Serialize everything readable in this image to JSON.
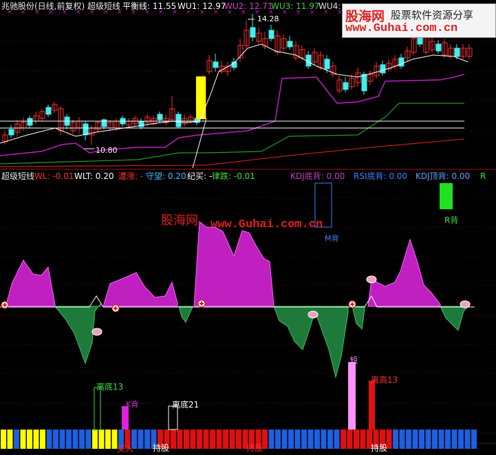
{
  "header": {
    "title": "兆驰股份(日线,前复权) 超级短线",
    "pingheng": "平衡线: 11.55",
    "wu1": "WU1: 12.97",
    "wu2": "WU2: 12.71",
    "wu3": "WU3: 11.97",
    "wu4": "WU4:"
  },
  "watermark": {
    "brand": "股海网",
    "slogan": "股票软件资源分享",
    "url": "www.Guhai.com.cn",
    "mid_brand": "股海网",
    "mid_url": "www.Guhai.com.cn"
  },
  "sub_header": {
    "name": "超级短线",
    "wl": "WL: -0.01",
    "wlt": "WLT: 0.20",
    "lianzhang": "遭涨: -",
    "shouwang": "守望: 0.20",
    "jimai": "纪买: -",
    "lvdie": "律跌: -0.01",
    "kdj_bottom": "KDJ底背: 0.00",
    "rsi_bottom": "RSI底背: 0.00",
    "kdj_top": "KDJ顶背: 0.00",
    "r": "R"
  },
  "annotations": {
    "price_high": "14.28",
    "price_low": "10.80",
    "m_bei": "M背",
    "r_bei": "R背",
    "k_bei": "K背",
    "duan": "短",
    "li_di_13": "离底13",
    "li_di_21": "离底21",
    "li_gao_13": "离高13",
    "buy": "买入",
    "hold1": "持股",
    "hold2": "持股",
    "hold3": "持股"
  },
  "colors": {
    "up": "#ff3030",
    "down": "#40f0f0",
    "magenta": "#c020c0",
    "green_fill": "#1e7a3a",
    "yellow": "#ffff00",
    "blue": "#1f5fe0",
    "red": "#e01010"
  },
  "chart_data": [
    {
      "type": "line",
      "title": "兆驰股份(日线,前复权) 超级短线",
      "series": [
        {
          "name": "平衡线",
          "last": 11.55
        },
        {
          "name": "WU1",
          "last": 12.97
        },
        {
          "name": "WU2",
          "last": 12.71
        },
        {
          "name": "WU3",
          "last": 11.97
        },
        {
          "name": "WU4",
          "last": null
        }
      ],
      "price_high": 14.28,
      "price_low": 10.8
    },
    {
      "type": "area",
      "title": "超级短线",
      "series": [
        {
          "name": "WL",
          "last": -0.01
        },
        {
          "name": "WLT",
          "last": 0.2
        },
        {
          "name": "守望",
          "last": 0.2
        },
        {
          "name": "律跌",
          "last": -0.01
        },
        {
          "name": "KDJ底背",
          "last": 0.0
        },
        {
          "name": "RSI底背",
          "last": 0.0
        },
        {
          "name": "KDJ顶背",
          "last": 0.0
        }
      ]
    }
  ]
}
